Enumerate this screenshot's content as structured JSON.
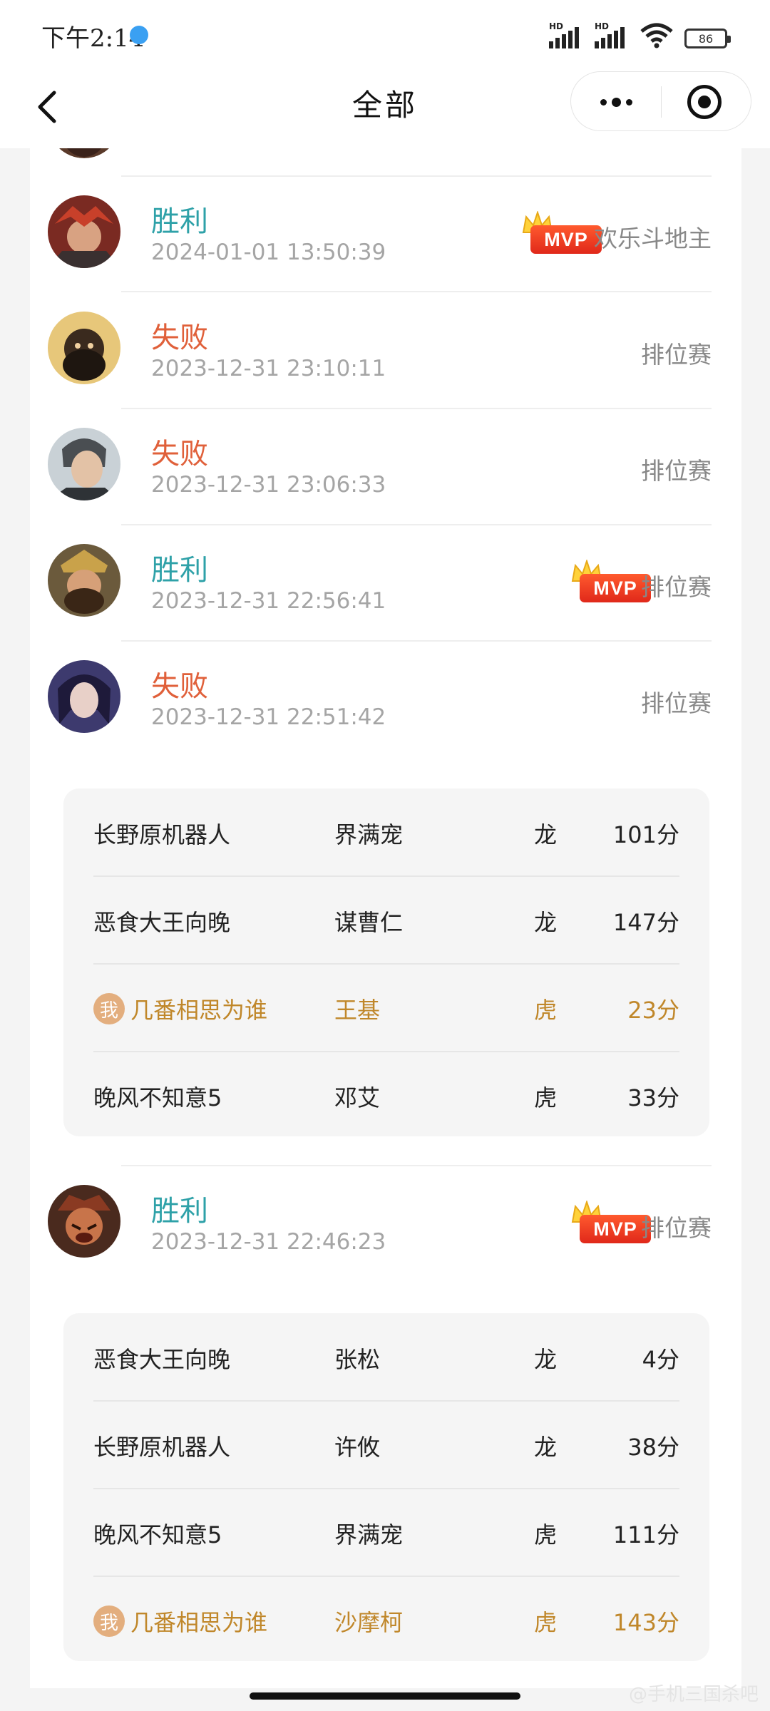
{
  "status_bar": {
    "time": "下午2:14",
    "signal1_label": "HD",
    "signal2_label": "HD",
    "battery": "86"
  },
  "nav": {
    "title": "全部",
    "back_icon": "chevron-left-icon",
    "more_icon": "more-dots-icon",
    "close_icon": "target-circle-icon"
  },
  "mvp_label": "MVP",
  "me_badge": "我",
  "records": [
    {
      "result": "胜利",
      "outcome": "win",
      "time": "2024-01-01 13:50:39",
      "mode": "欢乐斗地主",
      "mvp": true
    },
    {
      "result": "失败",
      "outcome": "lose",
      "time": "2023-12-31 23:10:11",
      "mode": "排位赛",
      "mvp": false
    },
    {
      "result": "失败",
      "outcome": "lose",
      "time": "2023-12-31 23:06:33",
      "mode": "排位赛",
      "mvp": false
    },
    {
      "result": "胜利",
      "outcome": "win",
      "time": "2023-12-31 22:56:41",
      "mode": "排位赛",
      "mvp": true
    },
    {
      "result": "失败",
      "outcome": "lose",
      "time": "2023-12-31 22:51:42",
      "mode": "排位赛",
      "mvp": false
    },
    {
      "result": "胜利",
      "outcome": "win",
      "time": "2023-12-31 22:46:23",
      "mode": "排位赛",
      "mvp": true
    }
  ],
  "details": [
    {
      "rows": [
        {
          "player": "长野原机器人",
          "hero": "界满宠",
          "team": "龙",
          "score": "101分",
          "me": false
        },
        {
          "player": "恶食大王向晚",
          "hero": "谋曹仁",
          "team": "龙",
          "score": "147分",
          "me": false
        },
        {
          "player": "几番相思为谁",
          "hero": "王基",
          "team": "虎",
          "score": "23分",
          "me": true
        },
        {
          "player": "晚风不知意5",
          "hero": "邓艾",
          "team": "虎",
          "score": "33分",
          "me": false
        }
      ]
    },
    {
      "rows": [
        {
          "player": "恶食大王向晚",
          "hero": "张松",
          "team": "龙",
          "score": "4分",
          "me": false
        },
        {
          "player": "长野原机器人",
          "hero": "许攸",
          "team": "龙",
          "score": "38分",
          "me": false
        },
        {
          "player": "晚风不知意5",
          "hero": "界满宠",
          "team": "虎",
          "score": "111分",
          "me": false
        },
        {
          "player": "几番相思为谁",
          "hero": "沙摩柯",
          "team": "虎",
          "score": "143分",
          "me": true
        }
      ]
    }
  ],
  "watermark": "@手机三国杀吧",
  "colors": {
    "win": "#2ea1a8",
    "lose": "#e0603a",
    "me": "#c0872a",
    "mvp": "#e0281a"
  }
}
